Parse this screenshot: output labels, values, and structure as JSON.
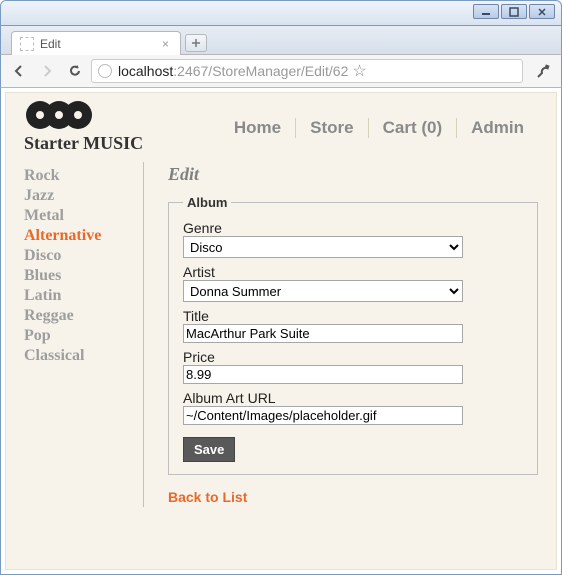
{
  "window": {
    "tab_title": "Edit"
  },
  "browser": {
    "url_host": "localhost",
    "url_port_path": ":2467/StoreManager/Edit/62"
  },
  "site": {
    "brand": "Starter MUSIC",
    "nav": {
      "home": "Home",
      "store": "Store",
      "cart": "Cart (0)",
      "admin": "Admin"
    }
  },
  "sidebar": {
    "items": [
      {
        "label": "Rock",
        "active": false
      },
      {
        "label": "Jazz",
        "active": false
      },
      {
        "label": "Metal",
        "active": false
      },
      {
        "label": "Alternative",
        "active": true
      },
      {
        "label": "Disco",
        "active": false
      },
      {
        "label": "Blues",
        "active": false
      },
      {
        "label": "Latin",
        "active": false
      },
      {
        "label": "Reggae",
        "active": false
      },
      {
        "label": "Pop",
        "active": false
      },
      {
        "label": "Classical",
        "active": false
      }
    ]
  },
  "main": {
    "title": "Edit",
    "legend": "Album",
    "labels": {
      "genre": "Genre",
      "artist": "Artist",
      "title": "Title",
      "price": "Price",
      "art_url": "Album Art URL"
    },
    "values": {
      "genre": "Disco",
      "artist": "Donna Summer",
      "title": "MacArthur Park Suite",
      "price": "8.99",
      "art_url": "~/Content/Images/placeholder.gif"
    },
    "save_label": "Save",
    "back_label": "Back to List"
  }
}
